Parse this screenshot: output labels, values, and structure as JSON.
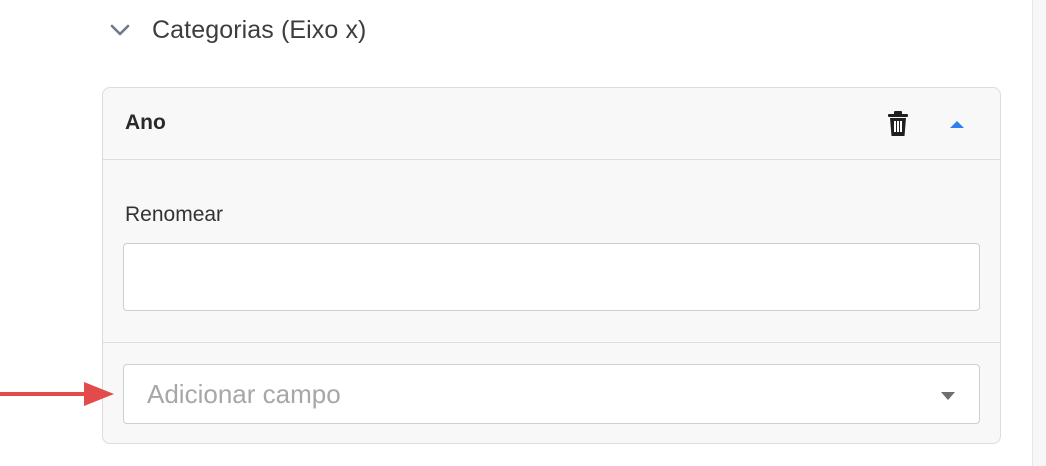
{
  "section": {
    "title": "Categorias (Eixo x)",
    "icon": "chevron-down-icon"
  },
  "card": {
    "title": "Ano",
    "delete_icon": "trash-icon",
    "collapse_icon": "caret-up-icon",
    "rename": {
      "label": "Renomear",
      "value": ""
    },
    "add_field": {
      "placeholder": "Adicionar campo",
      "icon": "caret-down-icon"
    }
  },
  "annotation": {
    "icon": "red-arrow-pointer",
    "color": "#e34b4b"
  },
  "colors": {
    "accent": "#2f80ed",
    "text": "#333333",
    "placeholder": "#a7a7a7",
    "border": "#dcdcdc",
    "card_bg": "#f8f8f8"
  }
}
